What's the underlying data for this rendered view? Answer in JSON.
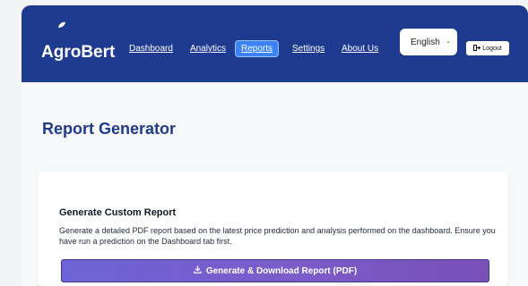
{
  "nav": {
    "brand": "AgroBert",
    "links": [
      "Dashboard",
      "Analytics",
      "Reports",
      "Settings",
      "About Us"
    ],
    "active": "Reports",
    "language": "English",
    "logout_label": "Logout",
    "colors": {
      "navbar_bg": "#1f3b8f",
      "active_tab": "#3b82f6"
    }
  },
  "page": {
    "title": "Report Generator"
  },
  "report_card": {
    "title": "Generate Custom Report",
    "description": "Generate a detailed PDF report based on the latest price prediction and analysis performed on the dashboard. Ensure you have run a prediction on the Dashboard tab first.",
    "button_label": "Generate & Download Report (PDF)",
    "button_icon": "download-icon"
  }
}
